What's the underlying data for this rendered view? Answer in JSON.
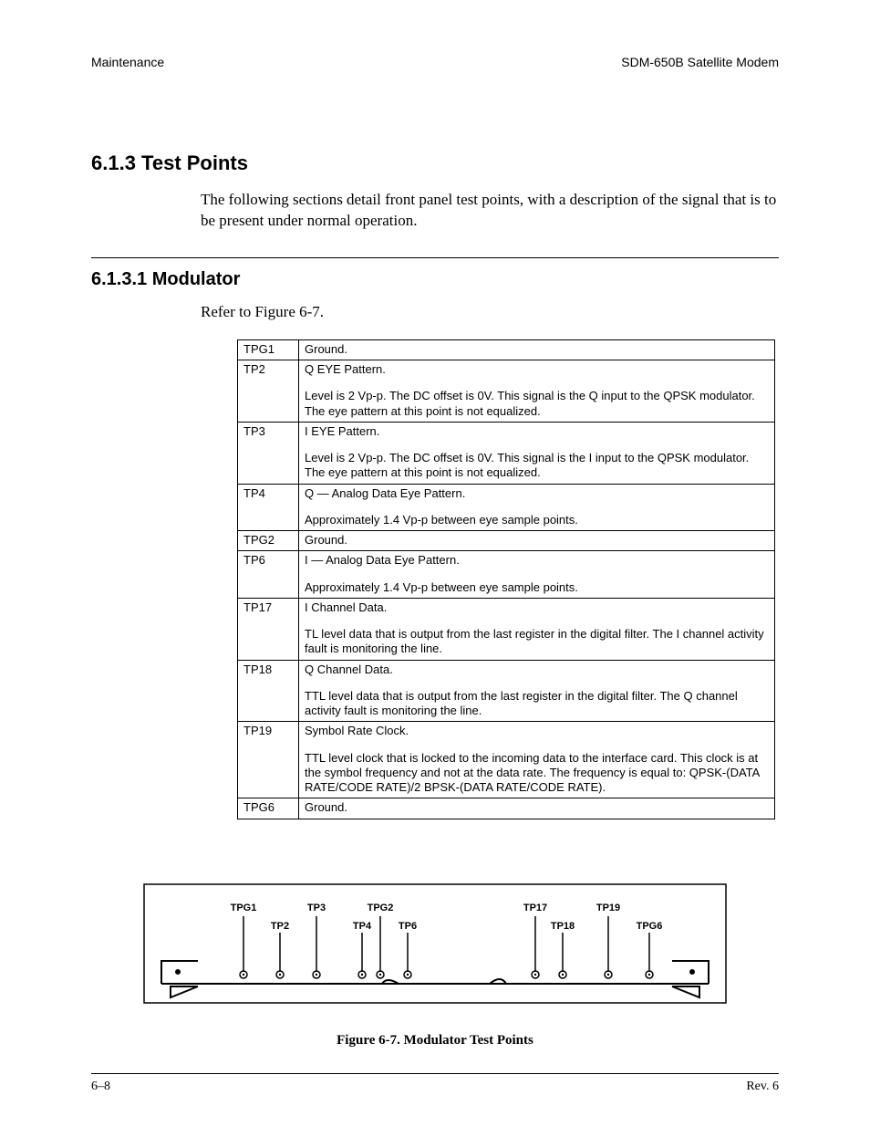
{
  "header": {
    "left": "Maintenance",
    "right": "SDM-650B Satellite Modem"
  },
  "section": {
    "number_title": "6.1.3  Test Points",
    "paragraph": "The following sections detail front panel test points, with a description of the signal that is to be present under normal operation."
  },
  "subsection": {
    "number_title": "6.1.3.1  Modulator",
    "reference": "Refer to Figure 6-7."
  },
  "table": {
    "rows": [
      {
        "label": "TPG1",
        "lines": [
          "Ground."
        ]
      },
      {
        "label": "TP2",
        "lines": [
          "Q EYE Pattern.",
          "",
          "Level is 2 Vp-p. The DC offset is 0V. This signal is the Q input to the QPSK modulator. The eye pattern at this point is not equalized."
        ]
      },
      {
        "label": "TP3",
        "lines": [
          "I EYE Pattern.",
          "",
          "Level is 2 Vp-p. The DC offset is 0V. This signal is the I input to the QPSK modulator. The eye pattern at this point is not equalized."
        ]
      },
      {
        "label": "TP4",
        "lines": [
          "Q — Analog Data Eye Pattern.",
          "",
          "Approximately 1.4 Vp-p between eye sample points."
        ]
      },
      {
        "label": "TPG2",
        "lines": [
          "Ground."
        ]
      },
      {
        "label": "TP6",
        "lines": [
          "I — Analog Data Eye Pattern.",
          "",
          "Approximately 1.4 Vp-p between eye sample points."
        ]
      },
      {
        "label": "TP17",
        "lines": [
          "I Channel Data.",
          "",
          "TL level data that is output from the last register in the digital filter. The I channel activity fault is monitoring the line."
        ]
      },
      {
        "label": "TP18",
        "lines": [
          "Q Channel Data.",
          "",
          "TTL level data that is output from the last register in the digital filter. The Q channel activity fault is monitoring the line."
        ]
      },
      {
        "label": "TP19",
        "lines": [
          "Symbol Rate Clock.",
          "",
          "TTL level clock that is locked to the incoming data to the interface card. This clock is at the symbol frequency and not at the data rate. The frequency is equal to: QPSK-(DATA RATE/CODE RATE)/2 BPSK-(DATA RATE/CODE RATE)."
        ]
      },
      {
        "label": "TPG6",
        "lines": [
          "Ground."
        ]
      }
    ]
  },
  "figure": {
    "caption": "Figure 6-7.  Modulator Test Points",
    "labels": {
      "TPG1": "TPG1",
      "TP2": "TP2",
      "TP3": "TP3",
      "TP4": "TP4",
      "TPG2": "TPG2",
      "TP6": "TP6",
      "TP17": "TP17",
      "TP18": "TP18",
      "TP19": "TP19",
      "TPG6": "TPG6"
    }
  },
  "footer": {
    "left": "6–8",
    "right": "Rev. 6"
  }
}
